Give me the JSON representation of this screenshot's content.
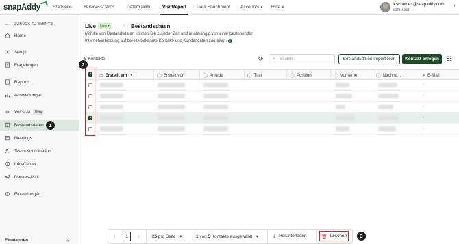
{
  "brand": {
    "name": "snapAddy",
    "accent": "#1f4a2a",
    "highlight": "#e01b1b"
  },
  "nav": {
    "items": [
      "Startseite",
      "BusinessCards",
      "DataQuality",
      "VisitReport",
      "Data Enrichment",
      "Accounts",
      "Hilfe"
    ],
    "active": "VisitReport"
  },
  "user": {
    "email": "a.schuldes@snapaddy.com",
    "name": "Toni Test"
  },
  "sidebar": {
    "back": "ZURÜCK ZU EVENTS",
    "items": [
      {
        "label": "Home",
        "icon": "home-icon"
      },
      {
        "label": "Setup",
        "icon": "setup-icon"
      },
      {
        "label": "Fragebogen",
        "icon": "questionnaire-icon"
      },
      {
        "label": "Reports",
        "icon": "reports-icon"
      },
      {
        "label": "Auswertungen",
        "icon": "chart-icon"
      },
      {
        "label": "Voice AI",
        "icon": "voice-icon",
        "badge": "Beta"
      },
      {
        "label": "Bestandsdaten",
        "icon": "book-icon",
        "active": true
      },
      {
        "label": "Meetings",
        "icon": "calendar-icon"
      },
      {
        "label": "Team-Koordination",
        "icon": "team-icon"
      },
      {
        "label": "Info-Center",
        "icon": "info-icon"
      },
      {
        "label": "Dankes-Mail",
        "icon": "send-icon"
      },
      {
        "label": "Einstellungen",
        "icon": "settings-icon"
      }
    ],
    "collapse": "Einklappen"
  },
  "page": {
    "crumb": "Live",
    "live_pill": "Live",
    "title": "Bestandsdaten",
    "description": "Mithilfe von Bestandsdaten können Sie zu jeder Zeit und unabhängig von einer bestehenden Internetverbindung auf bereits bekannte Kontakt- und Kundendaten zugreifen."
  },
  "toolbar": {
    "count": "5 Kontakte",
    "search_placeholder": "Search",
    "import_label": "Bestandsdaten importieren",
    "create_label": "Kontakt anlegen"
  },
  "table": {
    "columns": [
      "Erstellt am",
      "Erstellt von",
      "Anrede",
      "Titel",
      "Position",
      "Vorname",
      "Nachna...",
      "E-Mail"
    ],
    "sorted_column": "Erstellt am",
    "rows": [
      {
        "selected": false,
        "email": "-"
      },
      {
        "selected": false,
        "email": "-"
      },
      {
        "selected": false,
        "email": "-"
      },
      {
        "selected": true,
        "email": "-"
      },
      {
        "selected": false,
        "email": "-"
      }
    ]
  },
  "footer": {
    "page": "1",
    "per_page": "25",
    "per_page_suffix": "pro Seite",
    "selection_prefix": "1",
    "selection_middle": "von",
    "selection_total": "5",
    "selection_suffix": "Kontakte ausgewählt",
    "download_label": "Herunterladen",
    "delete_label": "Löschen"
  },
  "annotations": {
    "one": "1",
    "two": "2",
    "three": "3"
  }
}
